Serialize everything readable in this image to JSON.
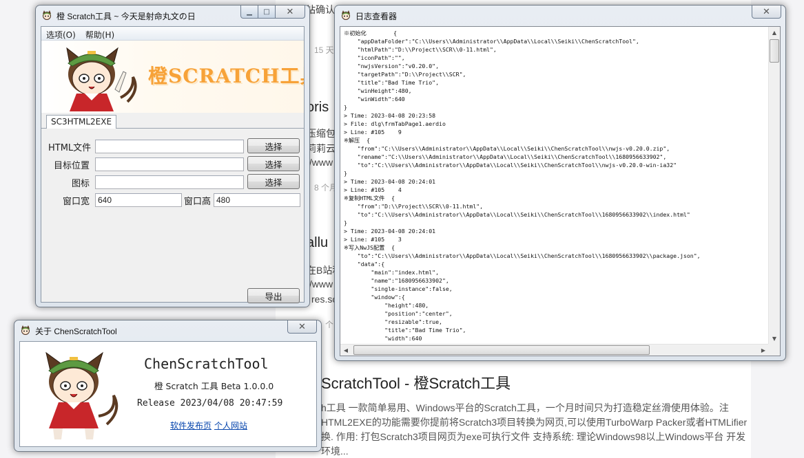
{
  "background_page": {
    "snippet_top": "已单站确认……",
    "meta_1": "15 天",
    "heading_1": "oris",
    "line_1a": "压缩包",
    "line_1b": "莉莉云",
    "line_1c": "//www",
    "meta_2": "8 个月",
    "heading_2": "allu",
    "line_2a": "在B站和",
    "line_2b": "//www",
    "line_2c": "res.sc",
    "meta_3": "个",
    "title": "ScratchTool - 橙Scratch工具",
    "desc_1": "h工具 一款简单易用、Windows平台的Scratch工具，一个月时间只为打造稳定丝滑使用体验。注",
    "desc_2": "HTML2EXE的功能需要你提前将Scratch3项目转换为网页,可以使用TurboWarp Packer或者HTMLifier",
    "desc_3": "换. 作用: 打包Scratch3项目网页为exe可执行文件 支持系统: 理论Windows98以上Windows平台 开发",
    "desc_4": "环境..."
  },
  "main_window": {
    "title": "橙 Scratch工具 ~ 今天是射命丸文の日",
    "menu": [
      "选项(O)",
      "帮助(H)"
    ],
    "banner_title": "橙SCRATCH工具",
    "tab": "SC3HTML2EXE",
    "fields": {
      "html_label": "HTML文件",
      "html_value": "",
      "target_label": "目标位置",
      "target_value": "",
      "icon_label": "图标",
      "icon_value": "",
      "width_label": "窗口宽",
      "width_value": "640",
      "height_label": "窗口高",
      "height_value": "480"
    },
    "choose_button": "选择",
    "export_button": "导出"
  },
  "log_window": {
    "title": "日志查看器",
    "content": "※初始化        {\n    \"appDataFolder\":\"C:\\\\Users\\\\Administrator\\\\AppData\\\\Local\\\\Seiki\\\\ChenScratchTool\",\n    \"htmlPath\":\"D:\\\\Project\\\\SCR\\\\0-11.html\",\n    \"iconPath\":\"\",\n    \"nwjsVersion\":\"v0.20.0\",\n    \"targetPath\":\"D:\\\\Project\\\\SCR\",\n    \"title\":\"Bad Time Trio\",\n    \"winHeight\":480,\n    \"winWidth\":640\n}\n> Time: 2023-04-08 20:23:58\n> File: dlg\\frmTabPage1.aerdio\n> Line: #105    9\n※解压  {\n    \"from\":\"C:\\\\Users\\\\Administrator\\\\AppData\\\\Local\\\\Seiki\\\\ChenScratchTool\\\\nwjs-v0.20.0.zip\",\n    \"rename\":\"C:\\\\Users\\\\Administrator\\\\AppData\\\\Local\\\\Seiki\\\\ChenScratchTool\\\\1680956633902\",\n    \"to\":\"C:\\\\Users\\\\Administrator\\\\AppData\\\\Local\\\\Seiki\\\\ChenScratchTool\\\\nwjs-v0.20.0-win-ia32\"\n}\n> Time: 2023-04-08 20:24:01\n> Line: #105    4\n※复制HTML文件  {\n    \"from\":\"D:\\\\Project\\\\SCR\\\\0-11.html\",\n    \"to\":\"C:\\\\Users\\\\Administrator\\\\AppData\\\\Local\\\\Seiki\\\\ChenScratchTool\\\\1680956633902\\\\index.html\"\n}\n> Time: 2023-04-08 20:24:01\n> Line: #105    3\n※写入NwJS配置  {\n    \"to\":\"C:\\\\Users\\\\Administrator\\\\AppData\\\\Local\\\\Seiki\\\\ChenScratchTool\\\\1680956633902\\\\package.json\",\n    \"data\":{\n        \"main\":\"index.html\",\n        \"name\":\"1680956633902\",\n        \"single-instance\":false,\n        \"window\":{\n            \"height\":480,\n            \"position\":\"center\",\n            \"resizable\":true,\n            \"title\":\"Bad Time Trio\",\n            \"width\":640"
  },
  "about_window": {
    "title": "关于 ChenScratchTool",
    "app_name": "ChenScratchTool",
    "version": "橙 Scratch 工具 Beta 1.0.0.0",
    "release": "Release 2023/04/08 20:47:59",
    "link_release": "软件发布页",
    "link_website": "个人网站"
  },
  "icons": [
    "chen-app-icon",
    "minimize-icon",
    "maximize-icon",
    "close-icon",
    "scroll-up-icon",
    "scroll-down-icon",
    "scroll-left-icon",
    "scroll-right-icon"
  ],
  "colors": {
    "banner_title": "#f7a238",
    "close_button": "#c74a35",
    "link": "#0645ad"
  }
}
